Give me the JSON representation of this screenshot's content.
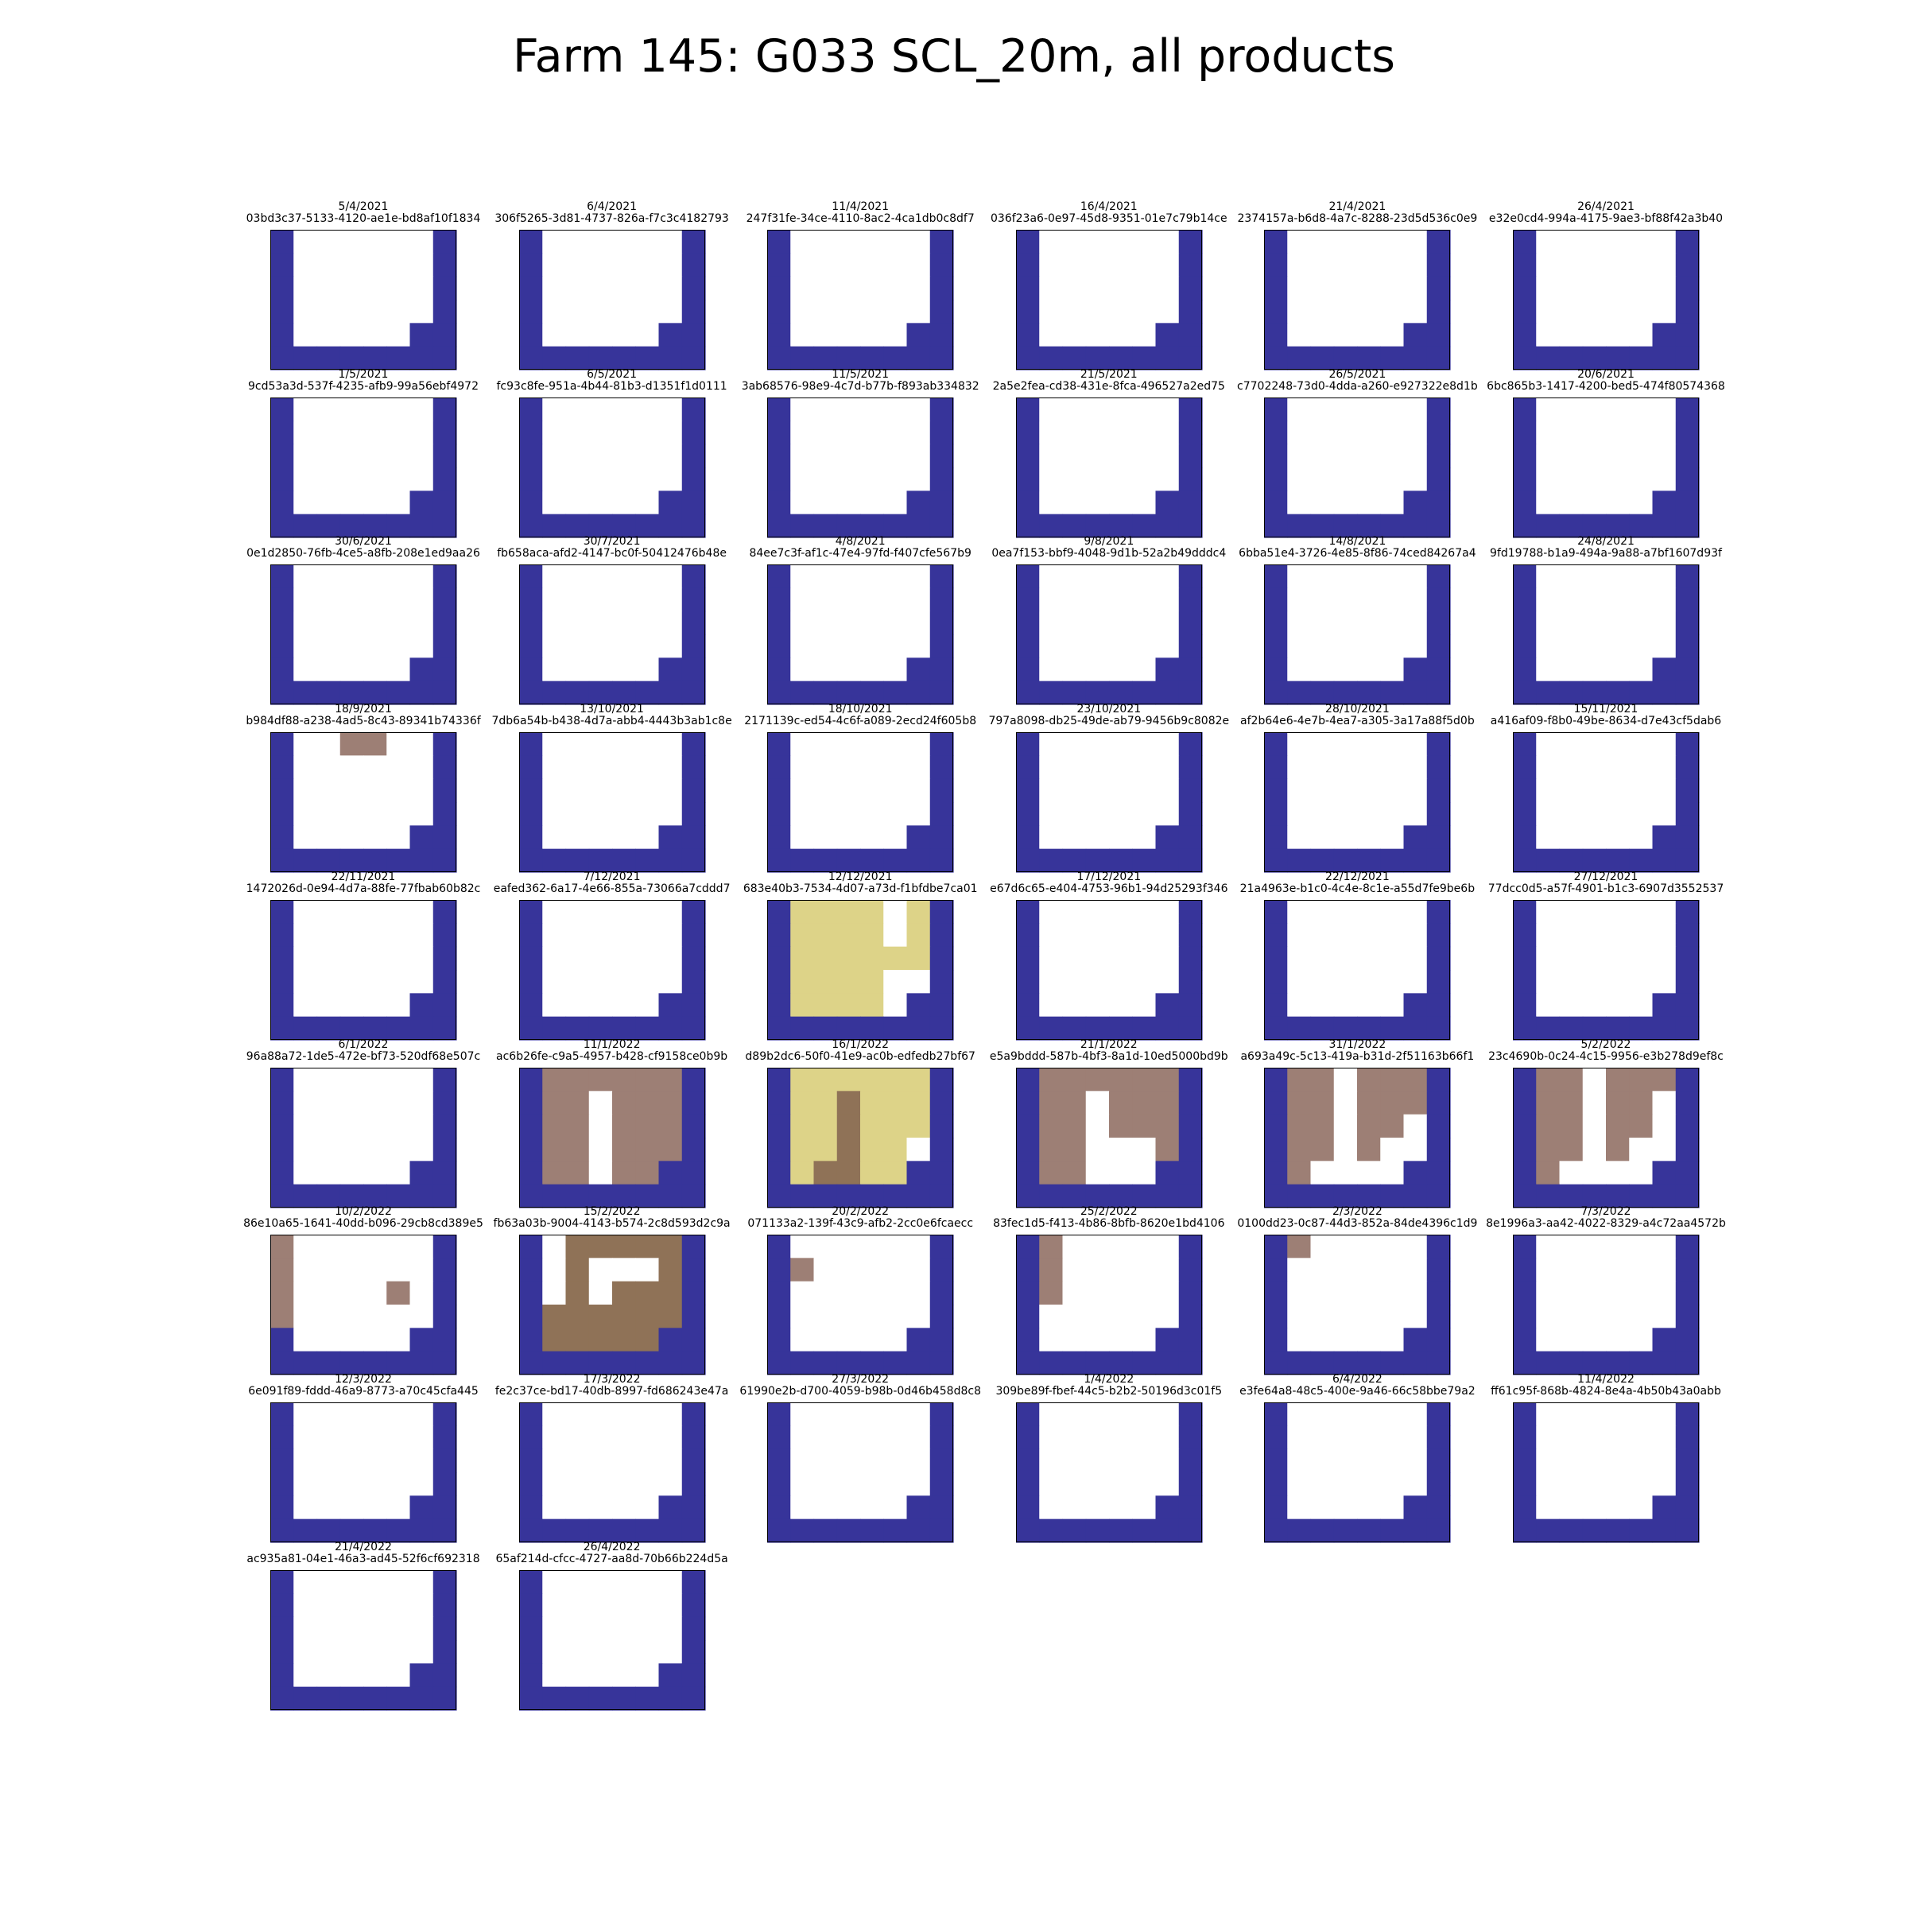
{
  "title": "Farm 145: G033 SCL_20m, all products",
  "colors": {
    "no_data": "#37349a",
    "field": "#ffffff",
    "soil": "#9d7f75",
    "vegetation": "#8f7257",
    "unclassified": "#ddd388",
    "border": "#000000"
  },
  "chart_data": {
    "type": "heatmap",
    "title": "Farm 145: G033 SCL_20m, all products",
    "grid_size": {
      "rows": 6,
      "cols": 8
    },
    "legend": "none",
    "base_mask": [
      "NFFFFFFN",
      "NFFFFFFN",
      "NFFFFFFN",
      "NFFFFFFN",
      "NFFFFFNN",
      "NNNNNNNN"
    ],
    "panels": [
      {
        "date": "5/4/2021",
        "id": "03bd3c37-5133-4120-ae1e-bd8af10f1834"
      },
      {
        "date": "6/4/2021",
        "id": "306f5265-3d81-4737-826a-f7c3c4182793"
      },
      {
        "date": "11/4/2021",
        "id": "247f31fe-34ce-4110-8ac2-4ca1db0c8df7"
      },
      {
        "date": "16/4/2021",
        "id": "036f23a6-0e97-45d8-9351-01e7c79b14ce"
      },
      {
        "date": "21/4/2021",
        "id": "2374157a-b6d8-4a7c-8288-23d5d536c0e9"
      },
      {
        "date": "26/4/2021",
        "id": "e32e0cd4-994a-4175-9ae3-bf88f42a3b40"
      },
      {
        "date": "1/5/2021",
        "id": "9cd53a3d-537f-4235-afb9-99a56ebf4972"
      },
      {
        "date": "6/5/2021",
        "id": "fc93c8fe-951a-4b44-81b3-d1351f1d0111"
      },
      {
        "date": "11/5/2021",
        "id": "3ab68576-98e9-4c7d-b77b-f893ab334832"
      },
      {
        "date": "21/5/2021",
        "id": "2a5e2fea-cd38-431e-8fca-496527a2ed75"
      },
      {
        "date": "26/5/2021",
        "id": "c7702248-73d0-4dda-a260-e927322e8d1b"
      },
      {
        "date": "20/6/2021",
        "id": "6bc865b3-1417-4200-bed5-474f80574368"
      },
      {
        "date": "30/6/2021",
        "id": "0e1d2850-76fb-4ce5-a8fb-208e1ed9aa26"
      },
      {
        "date": "30/7/2021",
        "id": "fb658aca-afd2-4147-bc0f-50412476b48e"
      },
      {
        "date": "4/8/2021",
        "id": "84ee7c3f-af1c-47e4-97fd-f407cfe567b9"
      },
      {
        "date": "9/8/2021",
        "id": "0ea7f153-bbf9-4048-9d1b-52a2b49dddc4"
      },
      {
        "date": "14/8/2021",
        "id": "6bba51e4-3726-4e85-8f86-74ced84267a4"
      },
      {
        "date": "24/8/2021",
        "id": "9fd19788-b1a9-494a-9a88-a7bf1607d93f"
      },
      {
        "date": "18/9/2021",
        "id": "b984df88-a238-4ad5-8c43-89341b74336f",
        "cells": [
          {
            "row": 0,
            "col": 3,
            "class": "soil"
          },
          {
            "row": 0,
            "col": 4,
            "class": "soil"
          }
        ]
      },
      {
        "date": "13/10/2021",
        "id": "7db6a54b-b438-4d7a-abb4-4443b3ab1c8e"
      },
      {
        "date": "18/10/2021",
        "id": "2171139c-ed54-4c6f-a089-2ecd24f605b8"
      },
      {
        "date": "23/10/2021",
        "id": "797a8098-db25-49de-ab79-9456b9c8082e"
      },
      {
        "date": "28/10/2021",
        "id": "af2b64e6-4e7b-4ea7-a305-3a17a88f5d0b"
      },
      {
        "date": "15/11/2021",
        "id": "a416af09-f8b0-49be-8634-d7e43cf5dab6"
      },
      {
        "date": "22/11/2021",
        "id": "1472026d-0e94-4d7a-88fe-77fbab60b82c"
      },
      {
        "date": "7/12/2021",
        "id": "eafed362-6a17-4e66-855a-73066a7cddd7"
      },
      {
        "date": "12/12/2021",
        "id": "683e40b3-7534-4d07-a73d-f1bfdbe7ca01",
        "mask": [
          "NUUUUFUN",
          "NUUUUFUN",
          "NUUUUUUN",
          "NUUUUFFN",
          "NUUUUFNN",
          "NNNNNNNN"
        ]
      },
      {
        "date": "17/12/2021",
        "id": "e67d6c65-e404-4753-96b1-94d25293f346"
      },
      {
        "date": "22/12/2021",
        "id": "21a4963e-b1c0-4c4e-8c1e-a55d7fe9be6b"
      },
      {
        "date": "27/12/2021",
        "id": "77dcc0d5-a57f-4901-b1c3-6907d3552537"
      },
      {
        "date": "6/1/2022",
        "id": "96a88a72-1de5-472e-bf73-520df68e507c"
      },
      {
        "date": "11/1/2022",
        "id": "ac6b26fe-c9a5-4957-b428-cf9158ce0b9b",
        "mask": [
          "NSSSSSSN",
          "NSSFSSSN",
          "NSSFSSSN",
          "NSSFSSSN",
          "NSSFSSNN",
          "NNNNNNNN"
        ]
      },
      {
        "date": "16/1/2022",
        "id": "d89b2dc6-50f0-41e9-ac0b-edfedb27bf67",
        "mask": [
          "NUUUUUUN",
          "NUUVUUUN",
          "NUUVUUUN",
          "NUUVUUFN",
          "NUVVUUNN",
          "NNNNNNNN"
        ]
      },
      {
        "date": "21/1/2022",
        "id": "e5a9bddd-587b-4bf3-8a1d-10ed5000bd9b",
        "mask": [
          "NSSSSSSN",
          "NSSFSSSN",
          "NSSFSSSN",
          "NSSFFFSN",
          "NSSFFFNN",
          "NNNNNNNN"
        ]
      },
      {
        "date": "31/1/2022",
        "id": "a693a49c-5c13-419a-b31d-2f51163b66f1",
        "mask": [
          "NSSFSSSN",
          "NSSFSSSN",
          "NSSFSSFN",
          "NSSFSFFN",
          "NSFFFFNN",
          "NNNNNNNN"
        ]
      },
      {
        "date": "5/2/2022",
        "id": "23c4690b-0c24-4c15-9956-e3b278d9ef8c",
        "mask": [
          "NSSFSSSN",
          "NSSFSSFN",
          "NSSFSSFN",
          "NSSFSFFN",
          "NSFFFFNN",
          "NNNNNNNN"
        ]
      },
      {
        "date": "10/2/2022",
        "id": "86e10a65-1641-40dd-b096-29cb8cd389e5",
        "mask": [
          "SFFFFFFN",
          "SFFFFFFN",
          "SFFFFSFN",
          "SFFFFFFN",
          "NFFFFFNN",
          "NNNNNNNN"
        ]
      },
      {
        "date": "15/2/2022",
        "id": "fb63a03b-9004-4143-b574-2c8d593d2c9a",
        "mask": [
          "NFVVVVVN",
          "NFVFFFVN",
          "NFVFVVVN",
          "NVVVVVVN",
          "NVVVVVNN",
          "NNNNNNNN"
        ]
      },
      {
        "date": "20/2/2022",
        "id": "071133a2-139f-43c9-afb2-2cc0e6fcaecc",
        "mask": [
          "NFFFFFFN",
          "NSFFFFFN",
          "NFFFFFFN",
          "NFFFFFFN",
          "NFFFFFNN",
          "NNNNNNNN"
        ]
      },
      {
        "date": "25/2/2022",
        "id": "83fec1d5-f413-4b86-8bfb-8620e1bd4106",
        "mask": [
          "NSFFFFFN",
          "NSFFFFFN",
          "NSFFFFFN",
          "NFFFFFFN",
          "NFFFFFNN",
          "NNNNNNNN"
        ]
      },
      {
        "date": "2/3/2022",
        "id": "0100dd23-0c87-44d3-852a-84de4396c1d9",
        "cells": [
          {
            "row": 0,
            "col": 1,
            "class": "soil"
          }
        ]
      },
      {
        "date": "7/3/2022",
        "id": "8e1996a3-aa42-4022-8329-a4c72aa4572b"
      },
      {
        "date": "12/3/2022",
        "id": "6e091f89-fddd-46a9-8773-a70c45cfa445"
      },
      {
        "date": "17/3/2022",
        "id": "fe2c37ce-bd17-40db-8997-fd686243e47a"
      },
      {
        "date": "27/3/2022",
        "id": "61990e2b-d700-4059-b98b-0d46b458d8c8"
      },
      {
        "date": "1/4/2022",
        "id": "309be89f-fbef-44c5-b2b2-50196d3c01f5"
      },
      {
        "date": "6/4/2022",
        "id": "e3fe64a8-48c5-400e-9a46-66c58bbe79a2"
      },
      {
        "date": "11/4/2022",
        "id": "ff61c95f-868b-4824-8e4a-4b50b43a0abb"
      },
      {
        "date": "21/4/2022",
        "id": "ac935a81-04e1-46a3-ad45-52f6cf692318"
      },
      {
        "date": "26/4/2022",
        "id": "65af214d-cfcc-4727-aa8d-70b66b224d5a"
      }
    ]
  }
}
